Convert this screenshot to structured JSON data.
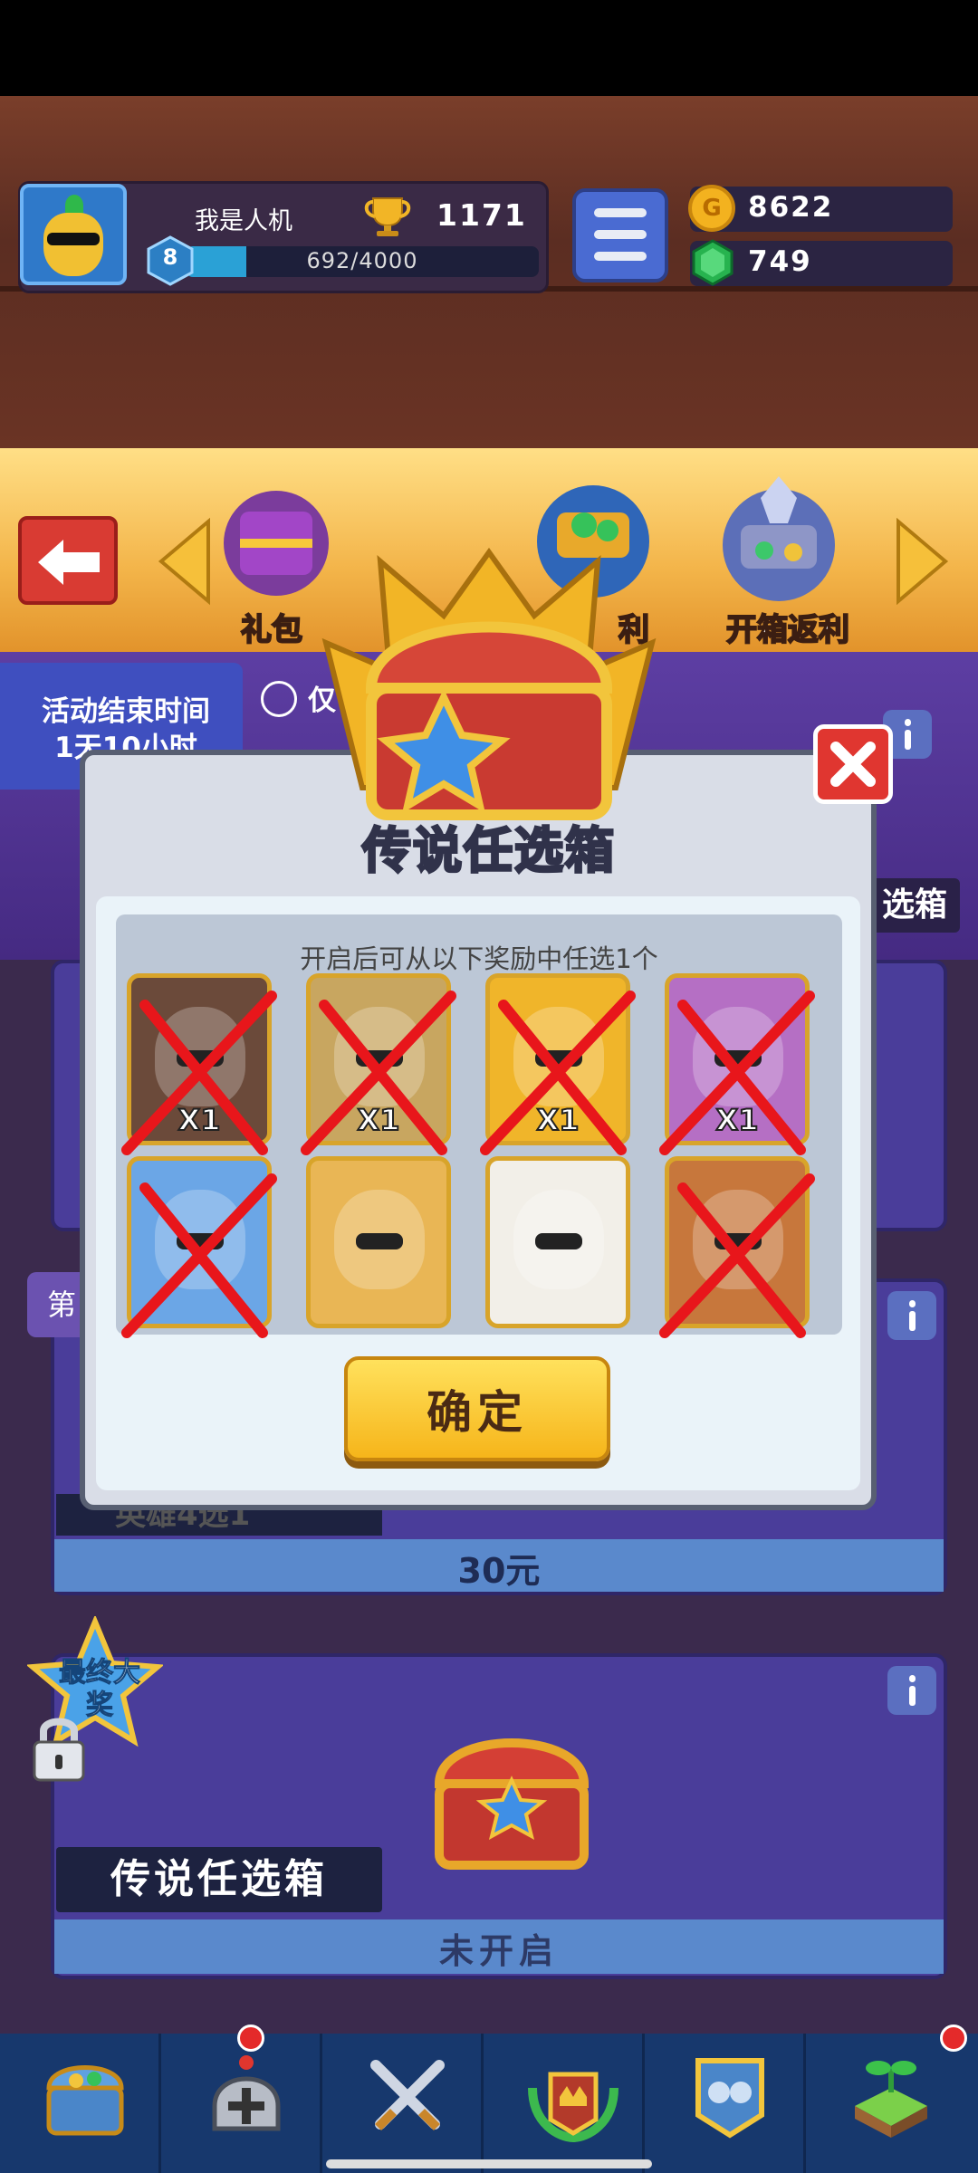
{
  "player": {
    "name": "我是人机",
    "trophies": "1171",
    "level": "8",
    "xp_text": "692/4000",
    "xp_progress": 0.173
  },
  "currency": {
    "gold": "8622",
    "gems": "749",
    "gold_icon_glyph": "G"
  },
  "nav": {
    "items": [
      {
        "label": "礼包"
      },
      {
        "label": "利"
      },
      {
        "label": "开箱返利"
      }
    ]
  },
  "event": {
    "time_title": "活动结束时间",
    "time_value": "1天10小时",
    "notice": "仅",
    "right_label": "选箱"
  },
  "card2": {
    "tab_label": "第",
    "label": "英雄4选1",
    "price": "30元"
  },
  "card3": {
    "badge": "最终大奖",
    "label": "传说任选箱",
    "status": "未开启"
  },
  "modal": {
    "title": "传说任选箱",
    "subtitle": "开启后可从以下奖励中任选1个",
    "confirm_label": "确定",
    "heroes": [
      {
        "qty": "X1",
        "color": "#6b4a3a",
        "crossed": true
      },
      {
        "qty": "X1",
        "color": "#c8a660",
        "crossed": true
      },
      {
        "qty": "X1",
        "color": "#f0b52a",
        "crossed": true
      },
      {
        "qty": "X1",
        "color": "#b56fc4",
        "crossed": true
      },
      {
        "qty": "",
        "color": "#6ba6e6",
        "crossed": true
      },
      {
        "qty": "",
        "color": "#e9b655",
        "crossed": false
      },
      {
        "qty": "",
        "color": "#f2efe8",
        "crossed": false
      },
      {
        "qty": "",
        "color": "#c7773c",
        "crossed": true
      }
    ]
  },
  "colors": {
    "accent_gold": "#f6b51a",
    "close_red": "#e03630",
    "cross_red": "#e8161b"
  },
  "bottom_tabs": [
    {
      "icon": "treasure-chest-icon"
    },
    {
      "icon": "helmet-icon"
    },
    {
      "icon": "crossed-swords-icon"
    },
    {
      "icon": "crown-laurel-icon"
    },
    {
      "icon": "team-banner-icon"
    },
    {
      "icon": "sprout-island-icon"
    }
  ]
}
